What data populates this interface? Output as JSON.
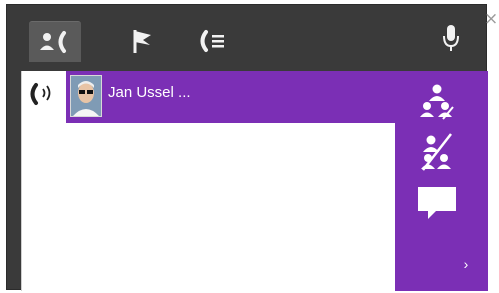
{
  "window": {
    "tabs": [
      {
        "name": "contacts-tab",
        "icon": "person-phone-icon",
        "active": true
      },
      {
        "name": "flag-tab",
        "icon": "flag-icon",
        "active": false
      },
      {
        "name": "call-list-tab",
        "icon": "call-list-icon",
        "active": false
      }
    ],
    "mic_icon": "microphone-icon",
    "close_label": "×"
  },
  "call": {
    "status_icon": "ringing-phone-icon",
    "contact_name": "Jan Ussel ..."
  },
  "side_actions": [
    {
      "name": "add-participant-button",
      "icon": "add-conference-icon"
    },
    {
      "name": "remove-participant-button",
      "icon": "remove-conference-icon"
    },
    {
      "name": "chat-button",
      "icon": "chat-bubble-icon"
    }
  ],
  "more_label": "›",
  "colors": {
    "accent": "#7b2fb5",
    "window_bg": "#3a3a3a",
    "active_tab": "#5a5a5a"
  }
}
